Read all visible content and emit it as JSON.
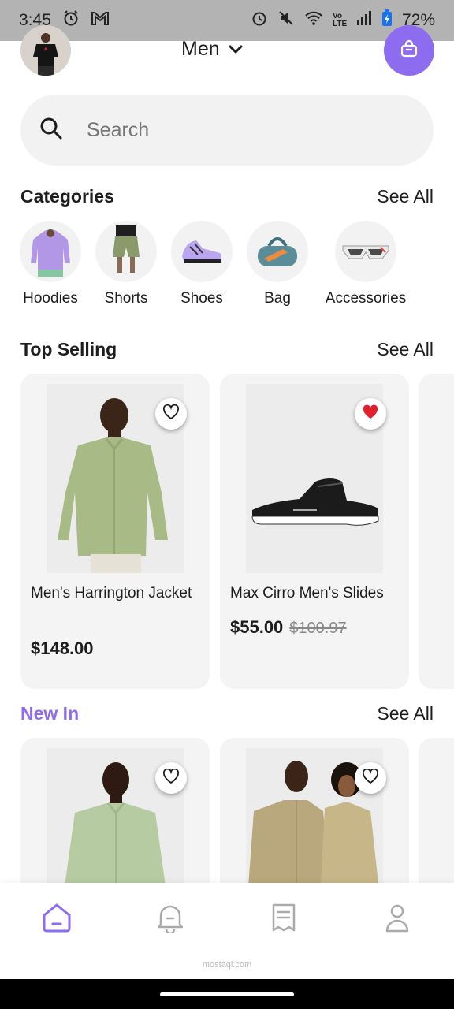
{
  "status_bar": {
    "time": "3:45",
    "battery": "72%",
    "network": "Vo LTE"
  },
  "header": {
    "gender": "Men"
  },
  "search": {
    "placeholder": "Search"
  },
  "categories": {
    "title": "Categories",
    "see_all": "See All",
    "items": [
      {
        "label": "Hoodies"
      },
      {
        "label": "Shorts"
      },
      {
        "label": "Shoes"
      },
      {
        "label": "Bag"
      },
      {
        "label": "Accessories"
      }
    ]
  },
  "top_selling": {
    "title": "Top Selling",
    "see_all": "See All",
    "products": [
      {
        "name": "Men's Harrington Jacket",
        "price": "$148.00",
        "old_price": "",
        "favorited": false
      },
      {
        "name": "Max Cirro Men's Slides",
        "price": "$55.00",
        "old_price": "$100.97",
        "favorited": true
      }
    ]
  },
  "new_in": {
    "title": "New In",
    "see_all": "See All",
    "title_color": "#8e6cef"
  },
  "bottom_nav": {
    "items": [
      {
        "icon": "home-icon",
        "active": true
      },
      {
        "icon": "bell-icon",
        "active": false
      },
      {
        "icon": "orders-icon",
        "active": false
      },
      {
        "icon": "profile-icon",
        "active": false
      }
    ]
  },
  "watermark": {
    "text": "mostaql.com"
  },
  "colors": {
    "accent": "#8e6cef",
    "favorite": "#e0202a",
    "card_bg": "#f4f4f4"
  }
}
